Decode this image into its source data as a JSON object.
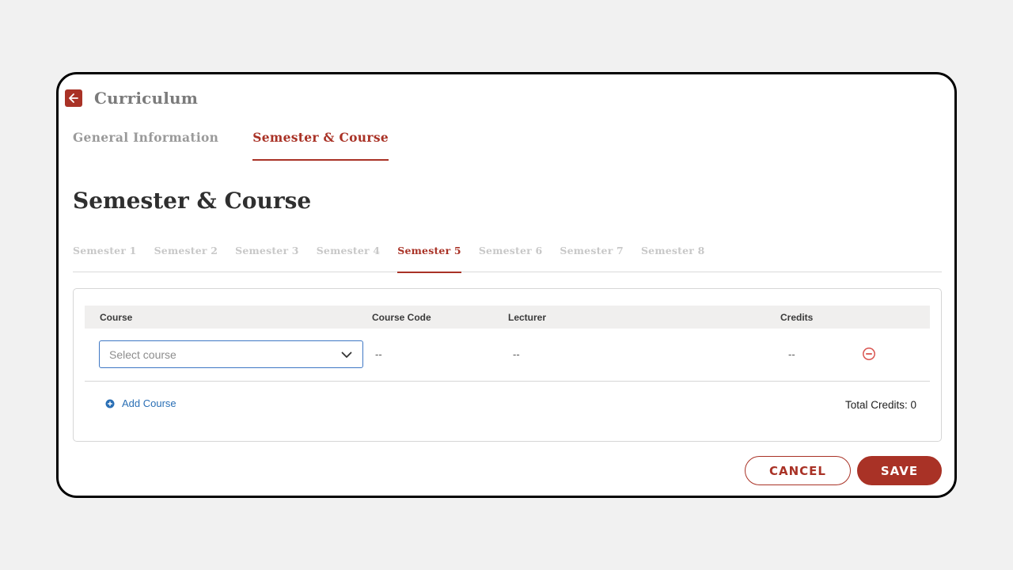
{
  "header": {
    "title": "Curriculum",
    "back_icon": "arrow-left-icon"
  },
  "main_tabs": [
    {
      "label": "General Information",
      "active": false
    },
    {
      "label": "Semester & Course",
      "active": true
    }
  ],
  "page_title": "Semester & Course",
  "semester_tabs": [
    {
      "label": "Semester 1",
      "active": false
    },
    {
      "label": "Semester 2",
      "active": false
    },
    {
      "label": "Semester 3",
      "active": false
    },
    {
      "label": "Semester 4",
      "active": false
    },
    {
      "label": "Semester 5",
      "active": true
    },
    {
      "label": "Semester 6",
      "active": false
    },
    {
      "label": "Semester 7",
      "active": false
    },
    {
      "label": "Semester 8",
      "active": false
    }
  ],
  "table": {
    "columns": [
      "Course",
      "Course Code",
      "Lecturer",
      "Credits"
    ],
    "rows": [
      {
        "course_placeholder": "Select course",
        "course_code": "--",
        "lecturer": "--",
        "credits": "--"
      }
    ]
  },
  "add_course_label": "Add Course",
  "total_credits": "Total Credits: 0",
  "buttons": {
    "cancel": "CANCEL",
    "save": "SAVE"
  },
  "colors": {
    "accent": "#a93226",
    "link": "#2a6fb5",
    "focus_border": "#3f78c4",
    "background": "#f1f1f1"
  }
}
